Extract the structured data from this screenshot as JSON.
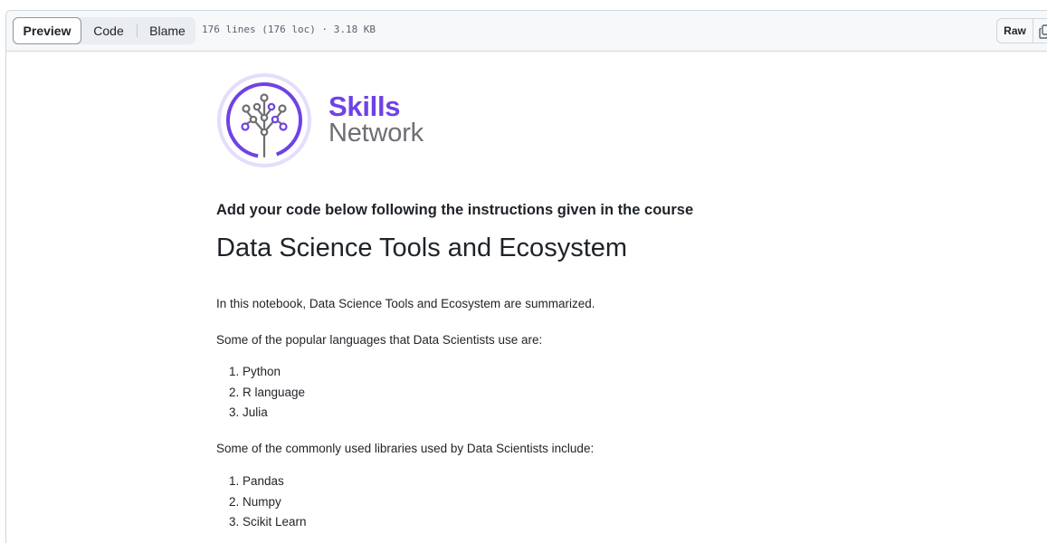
{
  "toolbar": {
    "tabs": [
      {
        "label": "Preview",
        "selected": true
      },
      {
        "label": "Code",
        "selected": false
      },
      {
        "label": "Blame",
        "selected": false
      }
    ],
    "file_info": "176 lines (176 loc) · 3.18 KB",
    "raw_label": "Raw",
    "copy_icon": "copy-icon"
  },
  "logo": {
    "word1": "Skills",
    "word2": "Network",
    "colors": {
      "primary": "#6f42e5",
      "ring": "#e6dcfb",
      "text_grey": "#6e6e73"
    }
  },
  "notebook": {
    "intro": "Add your code below following the instructions given in the course",
    "title": "Data Science Tools and Ecosystem",
    "summary": "In this notebook, Data Science Tools and Ecosystem are summarized.",
    "languages_heading": "Some of the popular languages that Data Scientists use are:",
    "languages": [
      "1. Python",
      "2. R language",
      "3. Julia"
    ],
    "libraries_heading": "Some of the commonly used libraries used by Data Scientists include:",
    "libraries": [
      "1. Pandas",
      "2. Numpy",
      "3. Scikit Learn"
    ]
  }
}
